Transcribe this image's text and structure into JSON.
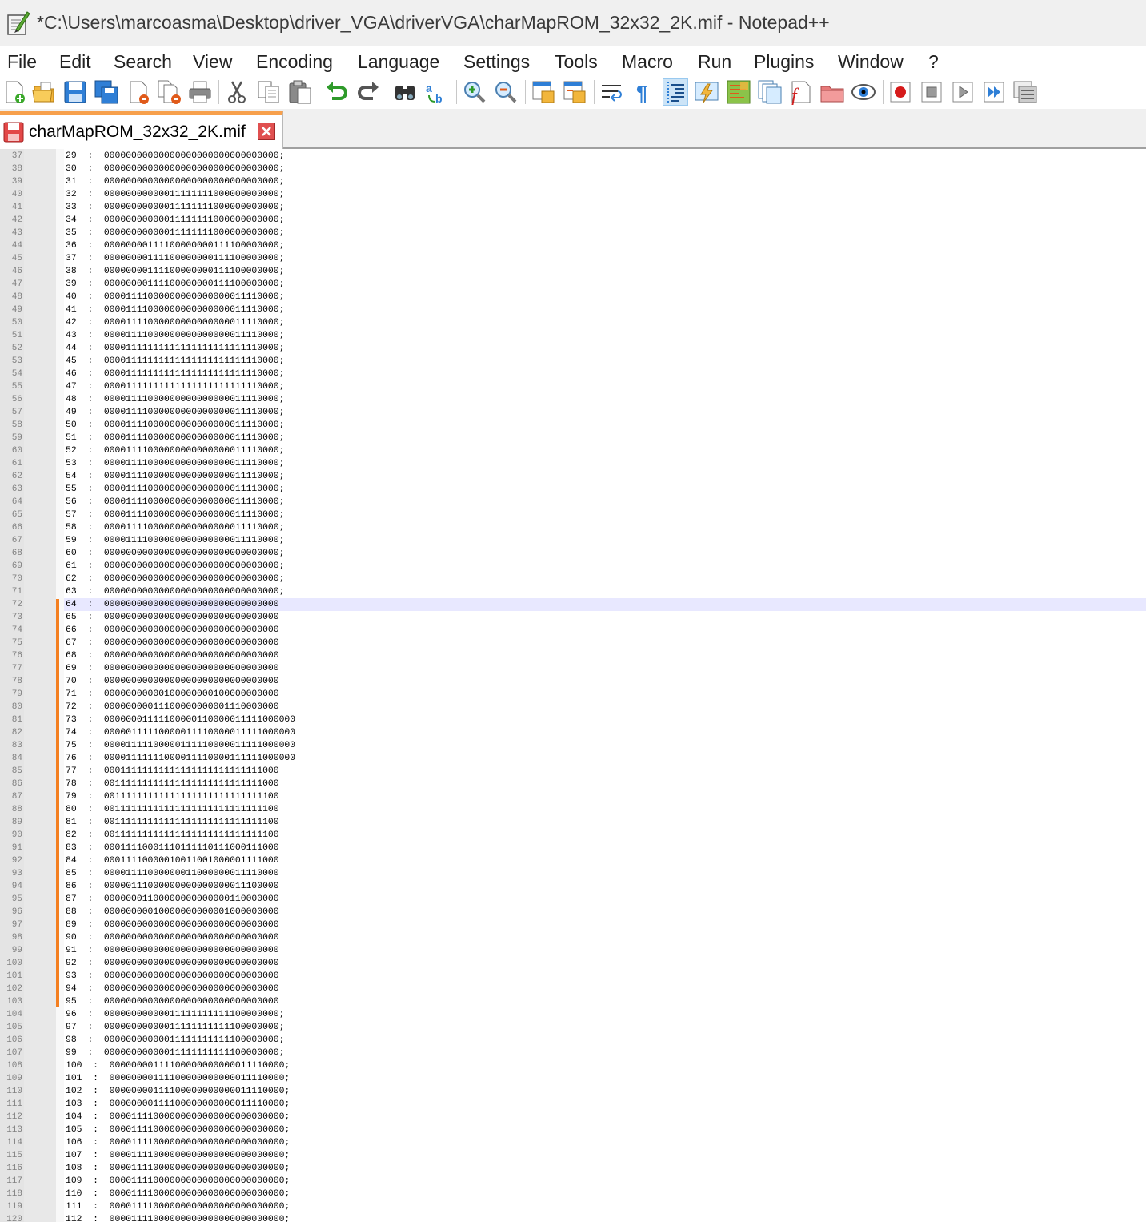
{
  "window": {
    "title": "*C:\\Users\\marcoasma\\Desktop\\driver_VGA\\driverVGA\\charMapROM_32x32_2K.mif - Notepad++"
  },
  "menu": {
    "items": [
      "File",
      "Edit",
      "Search",
      "View",
      "Encoding",
      "Language",
      "Settings",
      "Tools",
      "Macro",
      "Run",
      "Plugins",
      "Window",
      "?"
    ]
  },
  "toolbar": {
    "icons": [
      "new-file-icon",
      "open-file-icon",
      "save-icon",
      "save-all-icon",
      "close-icon",
      "close-all-icon",
      "print-icon",
      "cut-icon",
      "copy-icon",
      "paste-icon",
      "undo-icon",
      "redo-icon",
      "find-icon",
      "replace-icon",
      "zoom-in-icon",
      "zoom-out-icon",
      "sync-vertical-icon",
      "sync-horizontal-icon",
      "word-wrap-icon",
      "show-all-characters-icon",
      "indent-guide-icon",
      "user-defined-language-icon",
      "document-map-icon",
      "document-list-icon",
      "function-list-icon",
      "folder-as-workspace-icon",
      "monitoring-icon",
      "record-macro-icon",
      "stop-recording-icon",
      "playback-macro-icon",
      "run-macro-multiple-icon",
      "save-macro-icon"
    ]
  },
  "tab": {
    "title": "charMapROM_32x32_2K.mif"
  },
  "editor": {
    "first_line": 37,
    "current_line": 72,
    "lines": [
      "29  :  00000000000000000000000000000000;",
      "30  :  00000000000000000000000000000000;",
      "31  :  00000000000000000000000000000000;",
      "32  :  00000000000011111111000000000000;",
      "33  :  00000000000011111111000000000000;",
      "34  :  00000000000011111111000000000000;",
      "35  :  00000000000011111111000000000000;",
      "36  :  00000000111100000000111100000000;",
      "37  :  00000000111100000000111100000000;",
      "38  :  00000000111100000000111100000000;",
      "39  :  00000000111100000000111100000000;",
      "40  :  00001111000000000000000011110000;",
      "41  :  00001111000000000000000011110000;",
      "42  :  00001111000000000000000011110000;",
      "43  :  00001111000000000000000011110000;",
      "44  :  00001111111111111111111111110000;",
      "45  :  00001111111111111111111111110000;",
      "46  :  00001111111111111111111111110000;",
      "47  :  00001111111111111111111111110000;",
      "48  :  00001111000000000000000011110000;",
      "49  :  00001111000000000000000011110000;",
      "50  :  00001111000000000000000011110000;",
      "51  :  00001111000000000000000011110000;",
      "52  :  00001111000000000000000011110000;",
      "53  :  00001111000000000000000011110000;",
      "54  :  00001111000000000000000011110000;",
      "55  :  00001111000000000000000011110000;",
      "56  :  00001111000000000000000011110000;",
      "57  :  00001111000000000000000011110000;",
      "58  :  00001111000000000000000011110000;",
      "59  :  00001111000000000000000011110000;",
      "60  :  00000000000000000000000000000000;",
      "61  :  00000000000000000000000000000000;",
      "62  :  00000000000000000000000000000000;",
      "63  :  00000000000000000000000000000000;",
      "64  :  00000000000000000000000000000000",
      "65  :  00000000000000000000000000000000",
      "66  :  00000000000000000000000000000000",
      "67  :  00000000000000000000000000000000",
      "68  :  00000000000000000000000000000000",
      "69  :  00000000000000000000000000000000",
      "70  :  00000000000000000000000000000000",
      "71  :  00000000000100000000100000000000",
      "72  :  00000000011100000000001110000000",
      "73  :  00000001111100000110000011111000000",
      "74  :  00000111110000011110000011111000000",
      "75  :  00001111100000111110000011111000000",
      "76  :  00001111111000011110000111111000000",
      "77  :  00011111111111111111111111111000",
      "78  :  00111111111111111111111111111000",
      "79  :  00111111111111111111111111111100",
      "80  :  00111111111111111111111111111100",
      "81  :  00111111111111111111111111111100",
      "82  :  00111111111111111111111111111100",
      "83  :  00011110001110111110111000111000",
      "84  :  00011110000010011001000001111000",
      "85  :  00001111000000011000000011110000",
      "86  :  00000111000000000000000011100000",
      "87  :  00000001100000000000000110000000",
      "88  :  00000000010000000000001000000000",
      "89  :  00000000000000000000000000000000",
      "90  :  00000000000000000000000000000000",
      "91  :  00000000000000000000000000000000",
      "92  :  00000000000000000000000000000000",
      "93  :  00000000000000000000000000000000",
      "94  :  00000000000000000000000000000000",
      "95  :  00000000000000000000000000000000",
      "96  :  00000000000011111111111100000000;",
      "97  :  00000000000011111111111100000000;",
      "98  :  00000000000011111111111100000000;",
      "99  :  00000000000011111111111100000000;",
      "100  :  00000000111100000000000011110000;",
      "101  :  00000000111100000000000011110000;",
      "102  :  00000000111100000000000011110000;",
      "103  :  00000000111100000000000011110000;",
      "104  :  00001111000000000000000000000000;",
      "105  :  00001111000000000000000000000000;",
      "106  :  00001111000000000000000000000000;",
      "107  :  00001111000000000000000000000000;",
      "108  :  00001111000000000000000000000000;",
      "109  :  00001111000000000000000000000000;",
      "110  :  00001111000000000000000000000000;",
      "111  :  00001111000000000000000000000000;",
      "112  :  00001111000000000000000000000000;"
    ]
  },
  "colors": {
    "tab_accent": "#f7a04c",
    "change_bar": "#f47f20",
    "current_line": "#e8e8ff",
    "gutter": "#e4e4e4"
  }
}
